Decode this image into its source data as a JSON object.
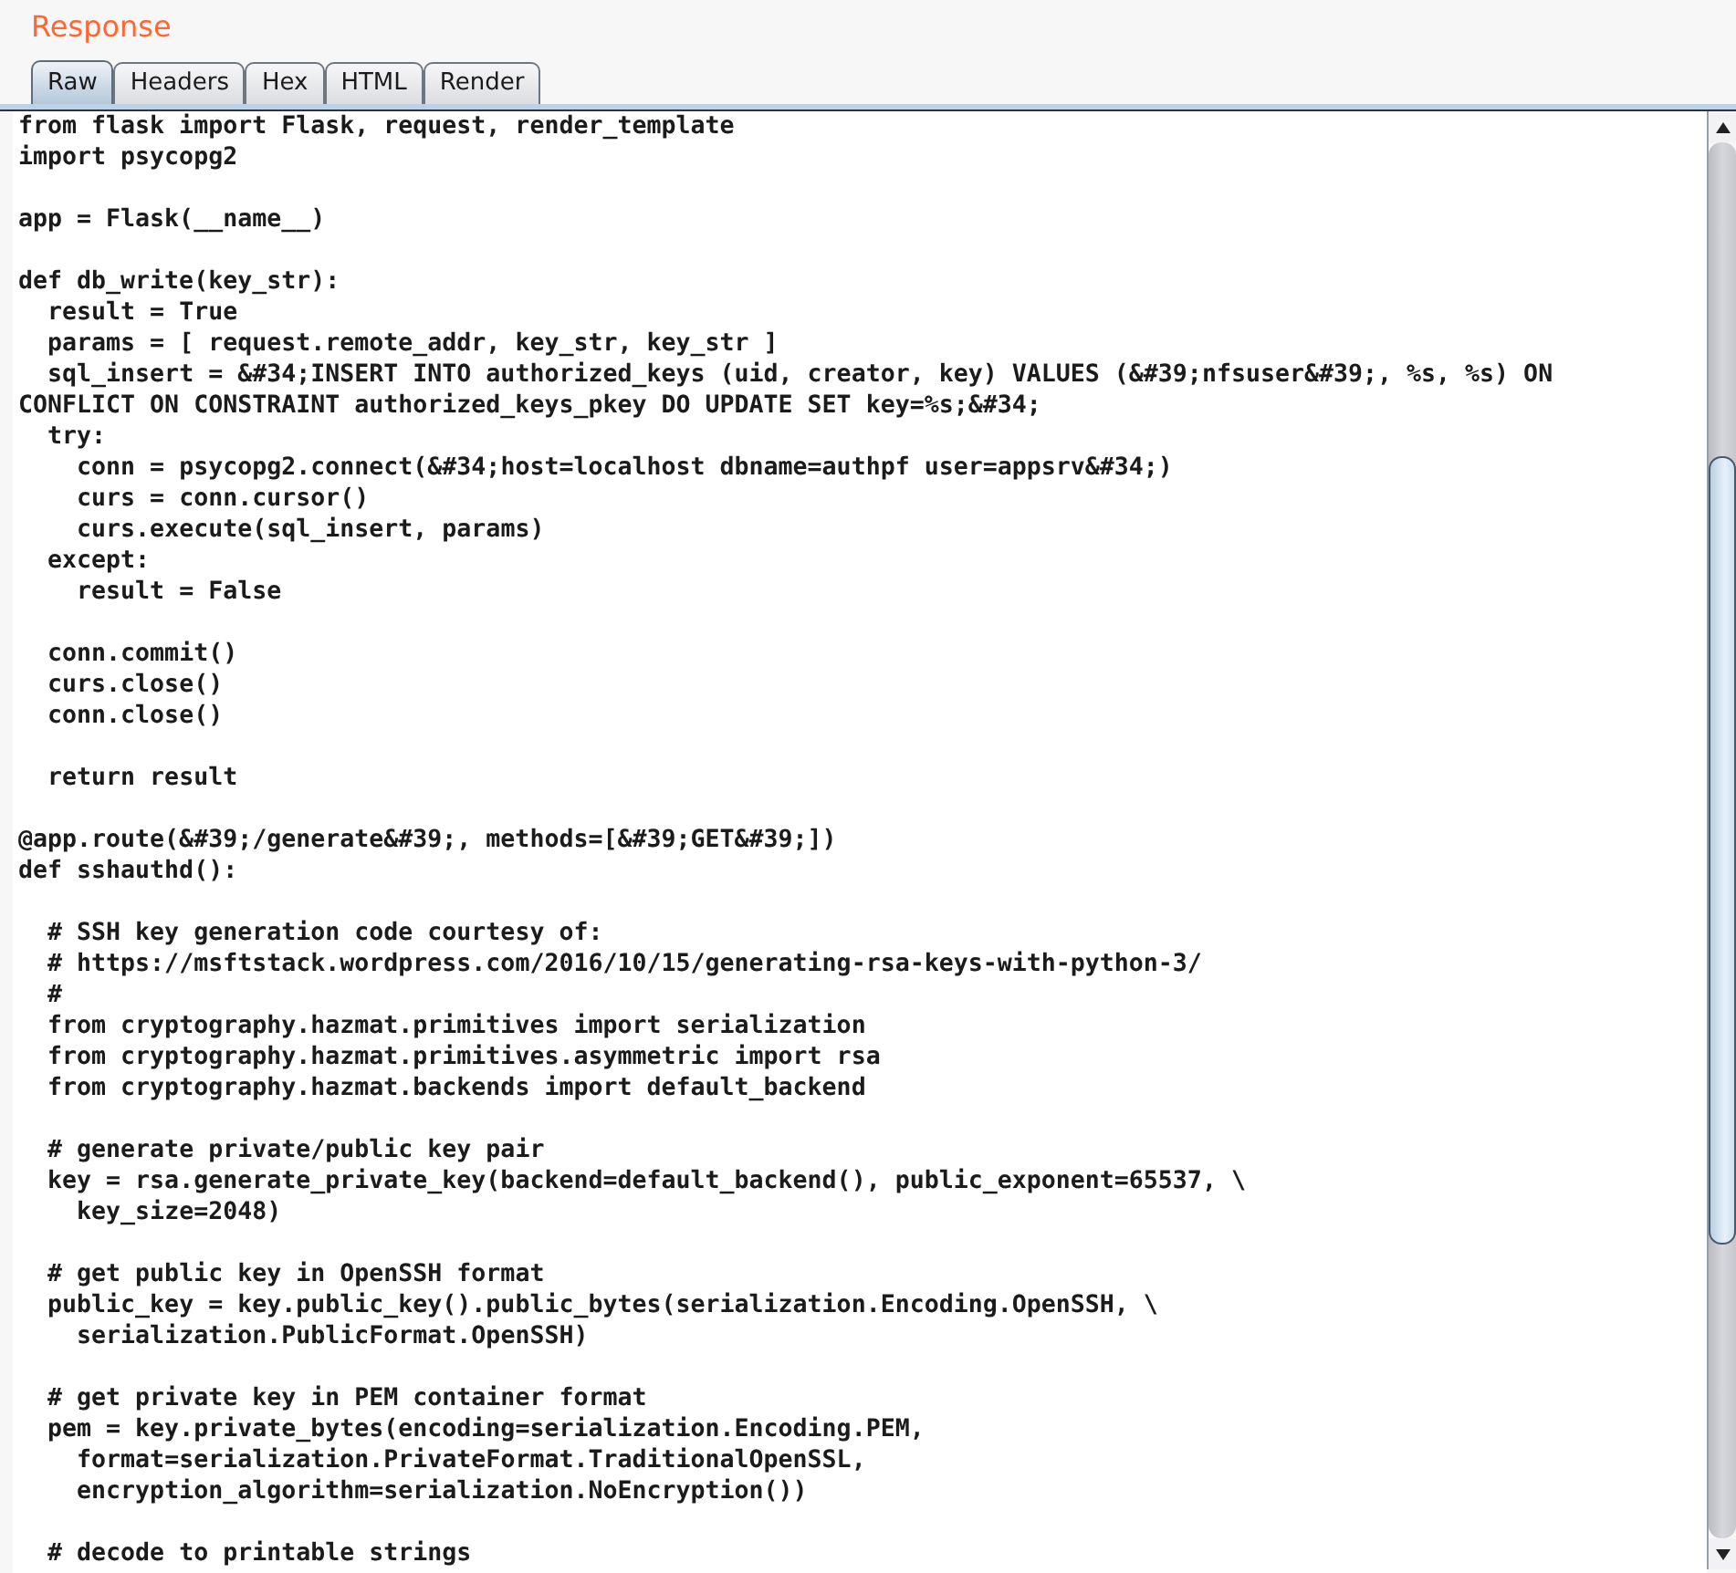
{
  "panel": {
    "title": "Response"
  },
  "tabs": [
    {
      "label": "Raw",
      "selected": true
    },
    {
      "label": "Headers",
      "selected": false
    },
    {
      "label": "Hex",
      "selected": false
    },
    {
      "label": "HTML",
      "selected": false
    },
    {
      "label": "Render",
      "selected": false
    }
  ],
  "body": {
    "blocks": [
      [
        "from flask import Flask, request, render_template",
        "import psycopg2"
      ],
      [
        "app = Flask(__name__)"
      ],
      [
        "def db_write(key_str):",
        "  result = True",
        "  params = [ request.remote_addr, key_str, key_str ]",
        "  sql_insert = &#34;INSERT INTO authorized_keys (uid, creator, key) VALUES (&#39;nfsuser&#39;, %s, %s) ON",
        "CONFLICT ON CONSTRAINT authorized_keys_pkey DO UPDATE SET key=%s;&#34;",
        "  try:",
        "    conn = psycopg2.connect(&#34;host=localhost dbname=authpf user=appsrv&#34;)",
        "    curs = conn.cursor()",
        "    curs.execute(sql_insert, params)",
        "  except:",
        "    result = False"
      ],
      [
        "  conn.commit()",
        "  curs.close()",
        "  conn.close()"
      ],
      [
        "  return result"
      ],
      [
        "@app.route(&#39;/generate&#39;, methods=[&#39;GET&#39;])",
        "def sshauthd():"
      ],
      [
        "  # SSH key generation code courtesy of:",
        "  # https://msftstack.wordpress.com/2016/10/15/generating-rsa-keys-with-python-3/",
        "  #",
        "  from cryptography.hazmat.primitives import serialization",
        "  from cryptography.hazmat.primitives.asymmetric import rsa",
        "  from cryptography.hazmat.backends import default_backend"
      ],
      [
        "  # generate private/public key pair",
        "  key = rsa.generate_private_key(backend=default_backend(), public_exponent=65537, \\",
        "    key_size=2048)"
      ],
      [
        "  # get public key in OpenSSH format",
        "  public_key = key.public_key().public_bytes(serialization.Encoding.OpenSSH, \\",
        "    serialization.PublicFormat.OpenSSH)"
      ],
      [
        "  # get private key in PEM container format",
        "  pem = key.private_bytes(encoding=serialization.Encoding.PEM,",
        "    format=serialization.PrivateFormat.TraditionalOpenSSL,",
        "    encryption_algorithm=serialization.NoEncryption())"
      ],
      [
        "  # decode to printable strings"
      ]
    ]
  }
}
